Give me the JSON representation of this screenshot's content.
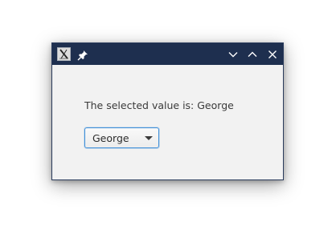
{
  "window": {
    "titlebar_color": "#1e2f4f",
    "icons": {
      "app": "app-icon",
      "pin": "pin-icon",
      "minimize": "chevron-down-icon",
      "maximize": "chevron-up-icon",
      "close": "close-icon"
    }
  },
  "main": {
    "label_text": "The selected value is: George",
    "combo": {
      "selected": "George",
      "accent": "#3f8fd8"
    }
  }
}
